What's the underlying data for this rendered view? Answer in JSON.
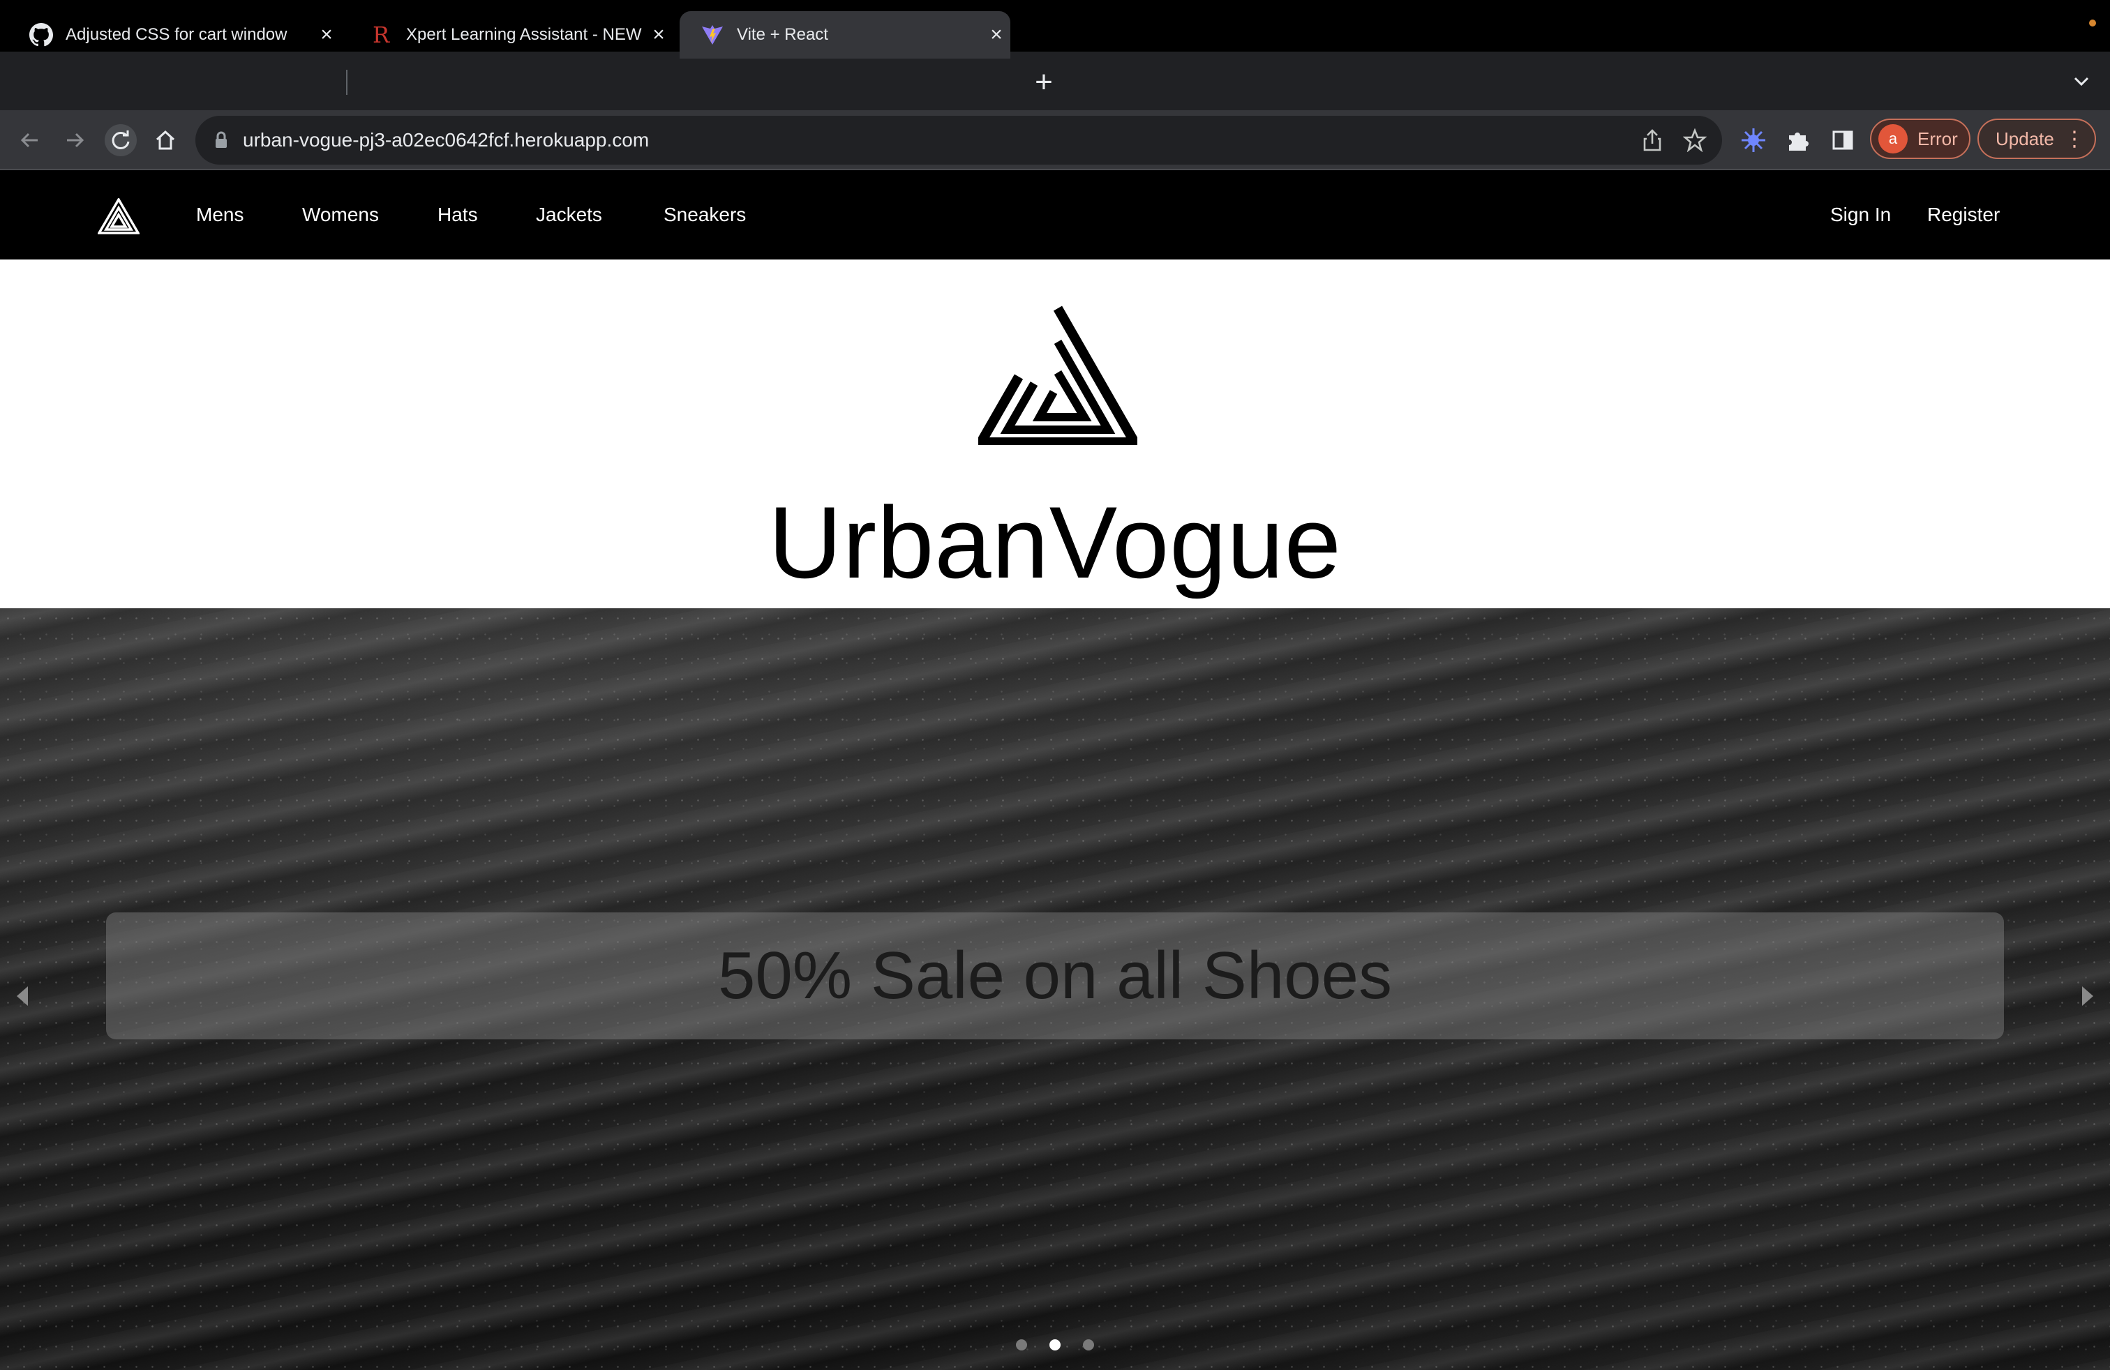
{
  "browser": {
    "tabs": [
      {
        "title": "Adjusted CSS for cart window",
        "favicon": "github-icon",
        "active": false
      },
      {
        "title": "Xpert Learning Assistant - NEW",
        "favicon": "r-logo-icon",
        "active": false
      },
      {
        "title": "Vite + React",
        "favicon": "vite-icon",
        "active": true
      }
    ],
    "url": "urban-vogue-pj3-a02ec0642fcf.herokuapp.com",
    "profile_initial": "a",
    "profile_status": "Error",
    "update_label": "Update"
  },
  "nav": {
    "links": [
      "Mens",
      "Womens",
      "Hats",
      "Jackets",
      "Sneakers"
    ],
    "sign_in": "Sign In",
    "register": "Register"
  },
  "brand": {
    "name": "UrbanVogue"
  },
  "carousel": {
    "slide_text": "50% Sale on all Shoes",
    "slide_count": 3,
    "active_slide": 2
  }
}
